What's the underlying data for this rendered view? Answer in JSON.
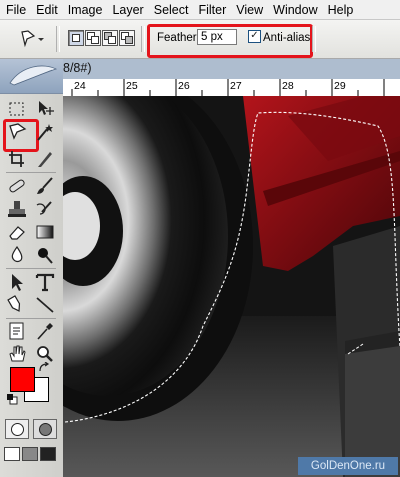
{
  "menu": [
    "File",
    "Edit",
    "Image",
    "Layer",
    "Select",
    "Filter",
    "View",
    "Window",
    "Help"
  ],
  "options": {
    "feather_label": "Feather:",
    "feather_value": "5 px",
    "anti_alias_label": "Anti-alias",
    "anti_alias_checked": true
  },
  "document": {
    "tab_text": "8/8#)"
  },
  "ruler": {
    "ticks": [
      "24",
      "25",
      "26",
      "27",
      "28",
      "29"
    ]
  },
  "colors": {
    "foreground": "#ff0000",
    "background": "#ffffff",
    "highlight": "#e4141b"
  },
  "toolbox": {
    "tools": [
      "rectangular-marquee-tool",
      "move-tool",
      "lasso-tool",
      "magic-wand-tool",
      "crop-tool",
      "slice-tool",
      "healing-brush-tool",
      "brush-tool",
      "clone-stamp-tool",
      "history-brush-tool",
      "eraser-tool",
      "gradient-tool",
      "blur-tool",
      "dodge-tool",
      "path-selection-tool",
      "type-tool",
      "pen-tool",
      "line-tool",
      "notes-tool",
      "eyedropper-tool",
      "hand-tool",
      "zoom-tool"
    ]
  },
  "watermark": "GolDenOne.ru"
}
